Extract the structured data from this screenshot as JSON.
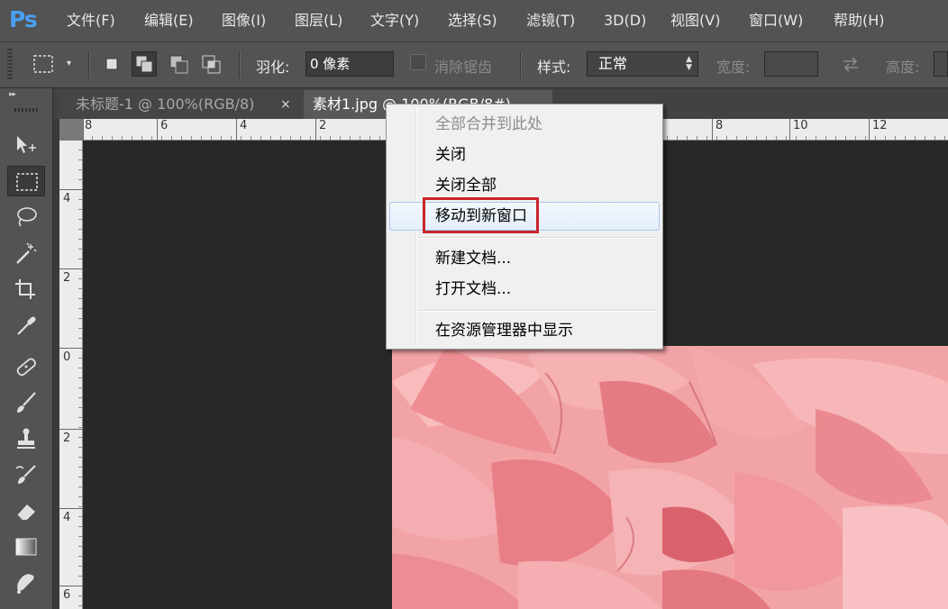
{
  "app": {
    "logo": "Ps",
    "colors": {
      "logo": "#4aa0f0",
      "menu_bg": "#535353",
      "workspace": "#282828",
      "highlight": "#c8252a"
    }
  },
  "menubar": {
    "items": [
      "文件(F)",
      "编辑(E)",
      "图像(I)",
      "图层(L)",
      "文字(Y)",
      "选择(S)",
      "滤镜(T)",
      "3D(D)",
      "视图(V)",
      "窗口(W)",
      "帮助(H)"
    ]
  },
  "options": {
    "feather_label": "羽化:",
    "feather_value": "0 像素",
    "antialias_label": "消除锯齿",
    "style_label": "样式:",
    "style_value": "正常",
    "width_label": "宽度:",
    "height_label": "高度:"
  },
  "tabs": [
    {
      "label": "未标题-1 @ 100%(RGB/8)",
      "close": "×",
      "active": false
    },
    {
      "label": "素材1.jpg @ 100%(RGB/8#)",
      "close": "×",
      "active": true
    }
  ],
  "rulers": {
    "top": [
      "8",
      "6",
      "4",
      "2",
      "8",
      "10",
      "12"
    ],
    "left": [
      "4",
      "2",
      "0",
      "2",
      "4",
      "6"
    ]
  },
  "tools": [
    "move-tool",
    "marquee-tool",
    "lasso-tool",
    "magic-wand-tool",
    "crop-tool",
    "eyedropper-tool",
    "healing-brush-tool",
    "brush-tool",
    "clone-stamp-tool",
    "history-brush-tool",
    "eraser-tool",
    "gradient-tool",
    "blur-tool"
  ],
  "context_menu": {
    "items": [
      {
        "label": "全部合并到此处",
        "enabled": false
      },
      {
        "label": "关闭",
        "enabled": true
      },
      {
        "label": "关闭全部",
        "enabled": true
      },
      {
        "label": "移动到新窗口",
        "enabled": true,
        "highlighted": true
      },
      {
        "label": "新建文档...",
        "enabled": true
      },
      {
        "label": "打开文档...",
        "enabled": true
      },
      {
        "label": "在资源管理器中显示",
        "enabled": true
      }
    ]
  }
}
